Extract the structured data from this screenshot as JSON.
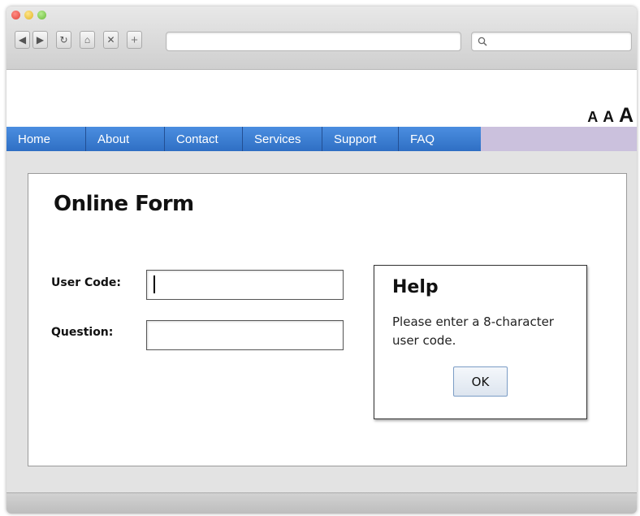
{
  "browser": {
    "toolbar": {
      "back_icon": "back-arrow-icon",
      "forward_icon": "forward-arrow-icon",
      "reload_icon": "reload-icon",
      "home_icon": "home-icon",
      "stop_icon": "close-icon",
      "new_tab_icon": "plus-icon"
    },
    "url_value": "",
    "search_value": "",
    "search_icon": "search-icon"
  },
  "text_size": {
    "small": "A",
    "medium": "A",
    "large": "A"
  },
  "nav": {
    "items": [
      {
        "label": "Home"
      },
      {
        "label": "About"
      },
      {
        "label": "Contact"
      },
      {
        "label": "Services"
      },
      {
        "label": "Support"
      },
      {
        "label": "FAQ"
      }
    ],
    "colors": {
      "bar": "#3a7fd5",
      "filler": "#cbc1dd"
    }
  },
  "form": {
    "title": "Online Form",
    "user_code_label": "User Code:",
    "user_code_value": "",
    "question_label": "Question:",
    "question_value": ""
  },
  "help": {
    "title": "Help",
    "text": "Please enter a 8-character user code.",
    "ok_label": "OK"
  }
}
